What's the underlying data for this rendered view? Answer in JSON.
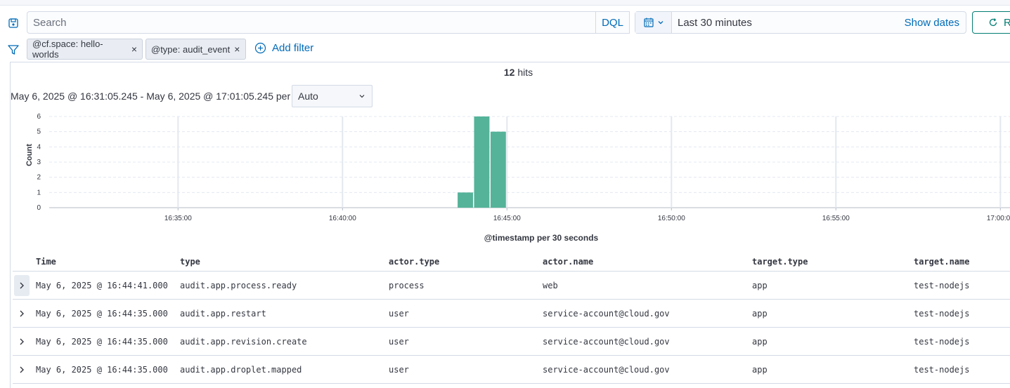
{
  "query_bar": {
    "search_placeholder": "Search",
    "language_label": "DQL",
    "time_range_label": "Last 30 minutes",
    "show_dates_label": "Show dates",
    "refresh_label": "R"
  },
  "filters": {
    "pills": [
      {
        "label": "@cf.space: hello-worlds"
      },
      {
        "label": "@type: audit_event"
      }
    ],
    "add_filter_label": "Add filter"
  },
  "results": {
    "hits_count": "12",
    "hits_suffix": "hits",
    "range_text": "May 6, 2025 @ 16:31:05.245 - May 6, 2025 @ 17:01:05.245 per",
    "interval_value": "Auto"
  },
  "chart_data": {
    "type": "bar",
    "xlabel": "@timestamp per 30 seconds",
    "ylabel": "Count",
    "ylim": [
      0,
      6
    ],
    "y_ticks": [
      0,
      1,
      2,
      3,
      4,
      5,
      6
    ],
    "x_range": [
      "16:31:05",
      "17:01:05"
    ],
    "x_ticks": [
      "16:35:00",
      "16:40:00",
      "16:45:00",
      "16:50:00",
      "16:55:00",
      "17:00:00"
    ],
    "grid": true,
    "bars": [
      {
        "x": "16:43:30",
        "value": 1
      },
      {
        "x": "16:44:00",
        "value": 6
      },
      {
        "x": "16:44:30",
        "value": 5
      }
    ],
    "color": "#54b399"
  },
  "table": {
    "columns": [
      "Time",
      "type",
      "actor.type",
      "actor.name",
      "target.type",
      "target.name"
    ],
    "rows": [
      [
        "May 6, 2025 @ 16:44:41.000",
        "audit.app.process.ready",
        "process",
        "web",
        "app",
        "test-nodejs"
      ],
      [
        "May 6, 2025 @ 16:44:35.000",
        "audit.app.restart",
        "user",
        "service-account@cloud.gov",
        "app",
        "test-nodejs"
      ],
      [
        "May 6, 2025 @ 16:44:35.000",
        "audit.app.revision.create",
        "user",
        "service-account@cloud.gov",
        "app",
        "test-nodejs"
      ],
      [
        "May 6, 2025 @ 16:44:35.000",
        "audit.app.droplet.mapped",
        "user",
        "service-account@cloud.gov",
        "app",
        "test-nodejs"
      ]
    ]
  }
}
